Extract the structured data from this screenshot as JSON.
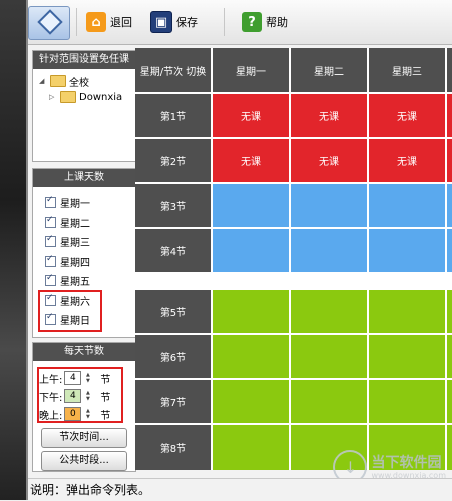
{
  "toolbar": {
    "back_label": "退回",
    "save_label": "保存",
    "help_label": "帮助"
  },
  "scope_panel": {
    "title": "针对范围设置免任课",
    "tree": [
      {
        "label": "全校"
      },
      {
        "label": "Downxia"
      }
    ]
  },
  "days_panel": {
    "title": "上课天数",
    "days": [
      "星期一",
      "星期二",
      "星期三",
      "星期四",
      "星期五",
      "星期六",
      "星期日"
    ]
  },
  "periods_panel": {
    "title": "每天节数",
    "rows": [
      {
        "label": "上午:",
        "value": "4",
        "unit": "节"
      },
      {
        "label": "下午:",
        "value": "4",
        "unit": "节"
      },
      {
        "label": "晚上:",
        "value": "0",
        "unit": "节"
      }
    ],
    "period_time_button": "节次时间...",
    "public_slot_button": "公共时段..."
  },
  "grid": {
    "corner": "星期/节次 切换",
    "columns": [
      "星期一",
      "星期二",
      "星期三"
    ],
    "rows": [
      "第1节",
      "第2节",
      "第3节",
      "第4节",
      "第5节",
      "第6节",
      "第7节",
      "第8节"
    ],
    "no_class_text": "无课",
    "colors": {
      "no_class": "#e2252b",
      "morning": "#5aa9ee",
      "afternoon": "#8bc90f"
    }
  },
  "status": {
    "text": "说明：弹出命令列表。"
  },
  "watermark": {
    "main": "当下软件园",
    "sub": "www.downxia.com"
  }
}
